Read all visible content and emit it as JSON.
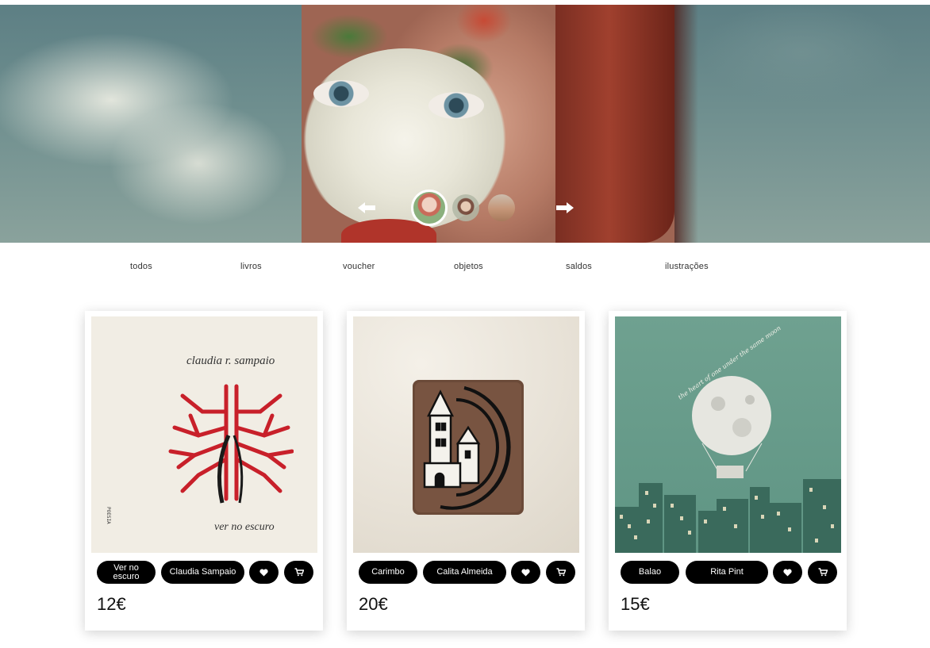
{
  "hero": {
    "prev_arrow": "🡐",
    "next_arrow": "🡒",
    "thumbnails": 3,
    "active_thumbnail": 1
  },
  "nav": {
    "items": [
      "todos",
      "livros",
      "voucher",
      "objetos",
      "saldos",
      "ilustrações"
    ]
  },
  "products": [
    {
      "cover_author": "claudia r. sampaio",
      "cover_title": "ver no escuro",
      "cover_spine": "POESIA",
      "name": "Ver no escuro",
      "author": "Claudia Sampaio",
      "price": "12€"
    },
    {
      "name": "Carimbo",
      "author": "Calita Almeida",
      "price": "20€"
    },
    {
      "cover_text": "the heart of one under the same moon",
      "name": "Balao",
      "author": "Rita Pint",
      "price": "15€"
    }
  ],
  "icons": {
    "favorite": "heart-icon",
    "cart": "cart-icon"
  },
  "colors": {
    "button_bg": "#000000",
    "button_text": "#ffffff",
    "card_shadow": "#cccccc"
  }
}
